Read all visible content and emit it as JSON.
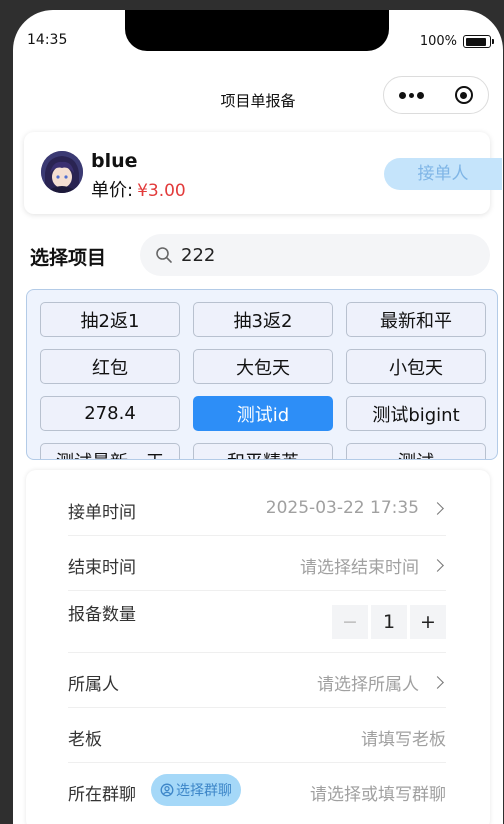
{
  "status": {
    "time": "14:35",
    "battery": "100%"
  },
  "nav": {
    "title": "项目单报备"
  },
  "user": {
    "name": "blue",
    "price_label": "单价:",
    "price_value": "¥3.00",
    "take_button": "接单人"
  },
  "project": {
    "section_title": "选择项目",
    "search_value": "222"
  },
  "items": [
    {
      "label": "抽2返1",
      "selected": false
    },
    {
      "label": "抽3返2",
      "selected": false
    },
    {
      "label": "最新和平",
      "selected": false
    },
    {
      "label": "红包",
      "selected": false
    },
    {
      "label": "大包天",
      "selected": false
    },
    {
      "label": "小包天",
      "selected": false
    },
    {
      "label": "278.4",
      "selected": false
    },
    {
      "label": "测试id",
      "selected": true
    },
    {
      "label": "测试bigint",
      "selected": false
    },
    {
      "label": "测试最新一天",
      "selected": false
    },
    {
      "label": "和平精英",
      "selected": false
    },
    {
      "label": "测试",
      "selected": false
    }
  ],
  "form": {
    "order_time": {
      "label": "接单时间",
      "value": "2025-03-22 17:35"
    },
    "end_time": {
      "label": "结束时间",
      "placeholder": "请选择结束时间"
    },
    "quantity": {
      "label": "报备数量",
      "value": "1",
      "minus": "−",
      "plus": "+"
    },
    "owner": {
      "label": "所属人",
      "placeholder": "请选择所属人"
    },
    "boss": {
      "label": "老板",
      "placeholder": "请填写老板"
    },
    "group": {
      "label": "所在群聊",
      "button": "选择群聊",
      "placeholder": "请选择或填写群聊"
    }
  },
  "colors": {
    "accent": "#2d8ef7",
    "price": "#e23b3b",
    "take_button_bg": "#c5e4fb"
  }
}
